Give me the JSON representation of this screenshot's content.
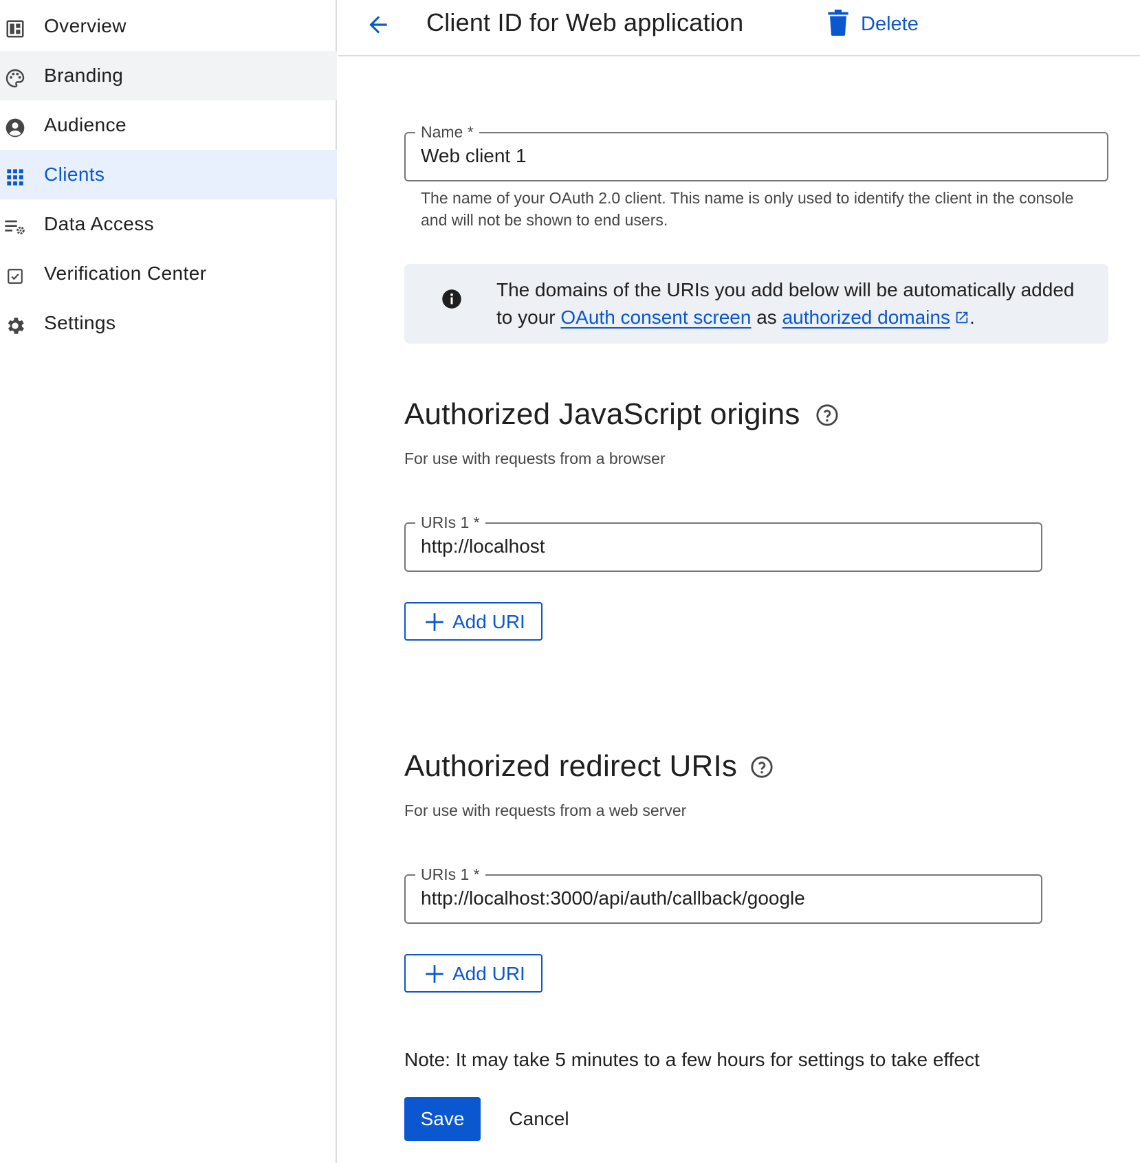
{
  "sidebar": {
    "items": [
      {
        "label": "Overview",
        "icon": "dashboard-icon"
      },
      {
        "label": "Branding",
        "icon": "palette-icon"
      },
      {
        "label": "Audience",
        "icon": "account-circle-icon"
      },
      {
        "label": "Clients",
        "icon": "apps-grid-icon"
      },
      {
        "label": "Data Access",
        "icon": "list-settings-icon"
      },
      {
        "label": "Verification Center",
        "icon": "checkbox-icon"
      },
      {
        "label": "Settings",
        "icon": "gear-icon"
      }
    ],
    "hovered_item": "Branding",
    "active_item": "Clients"
  },
  "header": {
    "title": "Client ID for Web application",
    "delete_label": "Delete"
  },
  "name_field": {
    "label": "Name *",
    "value": "Web client 1",
    "helper": "The name of your OAuth 2.0 client. This name is only used to identify the client in the console and will not be shown to end users."
  },
  "info": {
    "text_before": "The domains of the URIs you add below will be automatically added to your ",
    "link1": "OAuth consent screen",
    "text_middle": " as ",
    "link2": "authorized domains",
    "text_after": "."
  },
  "js_origins": {
    "title": "Authorized JavaScript origins",
    "subtitle": "For use with requests from a browser",
    "uri_label": "URIs 1 *",
    "uri_value": "http://localhost",
    "add_label": "Add URI"
  },
  "redirect_uris": {
    "title": "Authorized redirect URIs",
    "subtitle": "For use with requests from a web server",
    "uri_label": "URIs 1 *",
    "uri_value": "http://localhost:3000/api/auth/callback/google",
    "add_label": "Add URI"
  },
  "footer": {
    "note": "Note: It may take 5 minutes to a few hours for settings to take effect",
    "save_label": "Save",
    "cancel_label": "Cancel"
  },
  "colors": {
    "accent": "#0b57d0",
    "active_bg": "#e8f0fe",
    "hover_bg": "#f1f3f4",
    "info_bg": "#edf0f4"
  }
}
